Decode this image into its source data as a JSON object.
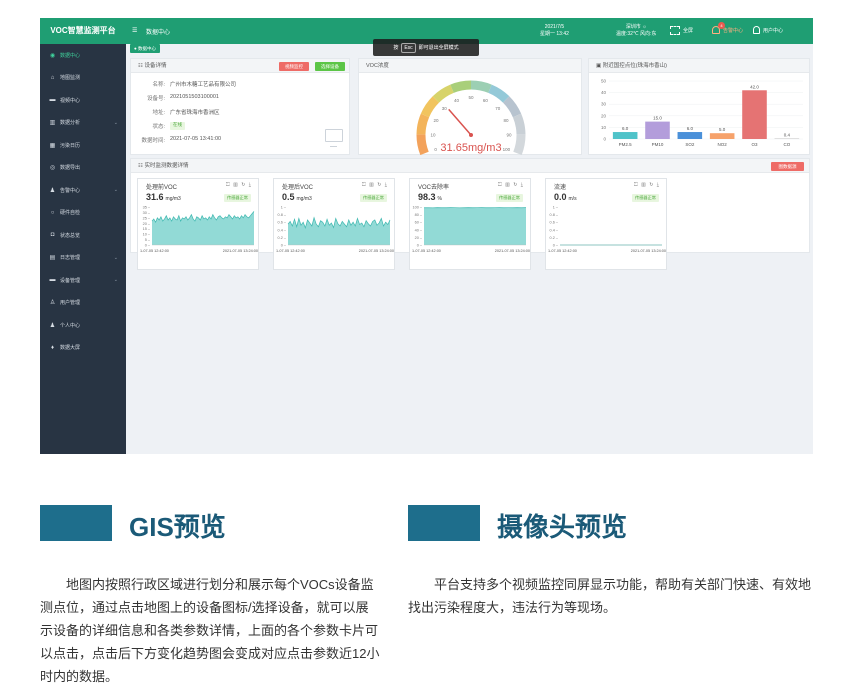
{
  "app": {
    "title": "VOC智慧监测平台",
    "breadcrumb": "数据中心",
    "home_tag": "数据中心"
  },
  "header": {
    "date": "2021/7/5",
    "time": "星期一 13:42",
    "weather_city": "深圳市 ☼",
    "weather_detail": "温度:32℃ 风向:东",
    "fullscreen_label": "全屏",
    "alarm_label": "告警中心",
    "alarm_count": "4",
    "user_label": "用户中心"
  },
  "esc_tip": {
    "prefix": "按",
    "key": "Esc",
    "suffix": "即可退出全屏模式"
  },
  "sidebar": {
    "items": [
      {
        "label": "数据中心",
        "icon": "dashboard-icon",
        "glyph": "◉",
        "active": true,
        "arrow": false
      },
      {
        "label": "地图监测",
        "icon": "map-icon",
        "glyph": "⌂",
        "active": false,
        "arrow": false
      },
      {
        "label": "视频中心",
        "icon": "video-icon",
        "glyph": "▬",
        "active": false,
        "arrow": false
      },
      {
        "label": "数据分析",
        "icon": "analysis-icon",
        "glyph": "▥",
        "active": false,
        "arrow": true
      },
      {
        "label": "污染日历",
        "icon": "calendar-icon",
        "glyph": "▦",
        "active": false,
        "arrow": false
      },
      {
        "label": "数据导出",
        "icon": "export-icon",
        "glyph": "◎",
        "active": false,
        "arrow": false
      },
      {
        "label": "告警中心",
        "icon": "bell-icon",
        "glyph": "♟",
        "active": false,
        "arrow": true
      },
      {
        "label": "硬件自检",
        "icon": "check-icon",
        "glyph": "○",
        "active": false,
        "arrow": false
      },
      {
        "label": "状态总览",
        "icon": "status-icon",
        "glyph": "◘",
        "active": false,
        "arrow": false
      },
      {
        "label": "日志管理",
        "icon": "log-icon",
        "glyph": "▤",
        "active": false,
        "arrow": true
      },
      {
        "label": "设备管理",
        "icon": "device-icon",
        "glyph": "▬",
        "active": false,
        "arrow": true
      },
      {
        "label": "用户管理",
        "icon": "users-icon",
        "glyph": "♙",
        "active": false,
        "arrow": false
      },
      {
        "label": "个人中心",
        "icon": "person-icon",
        "glyph": "♟",
        "active": false,
        "arrow": false
      },
      {
        "label": "数据大屏",
        "icon": "screen-icon",
        "glyph": "♦",
        "active": false,
        "arrow": false
      }
    ]
  },
  "device": {
    "title": "设备详情",
    "btn_monitor": "视频监控",
    "btn_select": "选择设备",
    "rows": [
      {
        "k": "名称:",
        "v": "广州市木糖工艺品有限公司"
      },
      {
        "k": "设备号:",
        "v": "2021051503100001"
      },
      {
        "k": "地址:",
        "v": "广东省珠海市香洲区"
      }
    ],
    "status_key": "状态:",
    "status_val": "在线",
    "time_key": "数据时间:",
    "time_val": "2021-07-05 13:41:00"
  },
  "gauge": {
    "title": "VOC浓度",
    "ticks": [
      "0",
      "10",
      "20",
      "30",
      "40",
      "50",
      "60",
      "70",
      "80",
      "90",
      "100"
    ],
    "max": 100,
    "value": 31.65,
    "value_text": "31.65mg/m3"
  },
  "air": {
    "title": "附近国控点位(珠海市香山)",
    "chart_data": {
      "type": "bar",
      "categories": [
        "PM2.5",
        "PM10",
        "SO2",
        "NO2",
        "O3",
        "CO"
      ],
      "values": [
        6.0,
        15.0,
        6.0,
        5.0,
        42.0,
        0.4
      ],
      "value_labels": [
        "6.0",
        "15.0",
        "6.0",
        "5.0",
        "42.0",
        "0.4"
      ],
      "yticks": [
        "50",
        "40",
        "30",
        "20",
        "10",
        "0"
      ],
      "ylim": [
        0,
        50
      ],
      "colors": [
        "#4fc3c9",
        "#b39ddb",
        "#4a90d9",
        "#f6a26b",
        "#e57373",
        "#bdbdbd"
      ]
    }
  },
  "realtime": {
    "title": "实时监测数据详情",
    "btn_bar": "图数据源",
    "cards": [
      {
        "name": "处理前VOC",
        "value": "31.6",
        "unit": "mg/m3",
        "status": "传感器正常",
        "yticks": [
          "35",
          "30",
          "25",
          "20",
          "15",
          "10",
          "5",
          "0"
        ],
        "ymax": 35,
        "x_start": "1-07-05 12:42:00",
        "x_end": "2021-07-05 13:24:00",
        "chart_data": {
          "type": "area",
          "series": [
            {
              "values": [
                22,
                24,
                21,
                25,
                23,
                26,
                22,
                24,
                27,
                23,
                25,
                22,
                26,
                24,
                23,
                27,
                22,
                25,
                24,
                26,
                23,
                25,
                28,
                24,
                22,
                26,
                25,
                23,
                27,
                24,
                25,
                23,
                26,
                24,
                28,
                25,
                23,
                26,
                27,
                25,
                24,
                26,
                25,
                28,
                26,
                24,
                27,
                25,
                26,
                24,
                27,
                25,
                28,
                26,
                25,
                27,
                29,
                31
              ]
            }
          ]
        }
      },
      {
        "name": "处理后VOC",
        "value": "0.5",
        "unit": "mg/m3",
        "status": "传感器正常",
        "yticks": [
          "1",
          "0.8",
          "0.6",
          "0.4",
          "0.2",
          "0"
        ],
        "ymax": 1,
        "x_start": "1-07-05 12:42:00",
        "x_end": "2021-07-05 13:24:00",
        "chart_data": {
          "type": "area",
          "series": [
            {
              "values": [
                0.55,
                0.62,
                0.5,
                0.68,
                0.48,
                0.7,
                0.52,
                0.6,
                0.45,
                0.66,
                0.58,
                0.5,
                0.72,
                0.55,
                0.48,
                0.64,
                0.6,
                0.5,
                0.68,
                0.52,
                0.58,
                0.46,
                0.7,
                0.56,
                0.5,
                0.62,
                0.55,
                0.48,
                0.66,
                0.52,
                0.6,
                0.5,
                0.7,
                0.54,
                0.58,
                0.48,
                0.64,
                0.56,
                0.5,
                0.62,
                0.66,
                0.52,
                0.58,
                0.7,
                0.5,
                0.6,
                0.54,
                0.66
              ]
            }
          ]
        }
      },
      {
        "name": "VOC去除率",
        "value": "98.3",
        "unit": "%",
        "status": "传感器正常",
        "yticks": [
          "100",
          "80",
          "60",
          "40",
          "20",
          "0"
        ],
        "ymax": 100,
        "x_start": "1-07-05 12:42:00",
        "x_end": "2021-07-05 13:24:00",
        "chart_data": {
          "type": "area",
          "series": [
            {
              "values": [
                98,
                98.2,
                97.9,
                98.4,
                98.1,
                98,
                98.3,
                98.2,
                97.8,
                98.1,
                98.4,
                98,
                98.2,
                98.3,
                98,
                98.1,
                98.2,
                98.3,
                98,
                98.2,
                98.1,
                98.4,
                98,
                98.3
              ]
            }
          ]
        }
      },
      {
        "name": "流速",
        "value": "0.0",
        "unit": "m/s",
        "status": "传感器正常",
        "yticks": [
          "1",
          "0.8",
          "0.6",
          "0.4",
          "0.2",
          "0"
        ],
        "ymax": 1,
        "x_start": "1-07-05 12:42:00",
        "x_end": "2021-07-05 13:24:00",
        "chart_data": {
          "type": "line",
          "series": [
            {
              "values": [
                0,
                0,
                0,
                0,
                0,
                0,
                0,
                0,
                0,
                0,
                0,
                0
              ]
            }
          ]
        }
      }
    ]
  },
  "sections": {
    "gis_title": "GIS预览",
    "gis_desc": "地图内按照行政区域进行划分和展示每个VOCs设备监测点位，通过点击地图上的设备图标/选择设备，就可以展示设备的详细信息和各类参数详情，上面的各个参数卡片可以点击，点击后下方变化趋势图会变成对应点击参数近12小时内的数据。",
    "cam_title": "摄像头预览",
    "cam_desc": "平台支持多个视频监控同屏显示功能，帮助有关部门快速、有效地找出污染程度大，违法行为等现场。"
  },
  "colors": {
    "brand": "#1f9e73",
    "sidebar": "#283443",
    "area": "#7fd3cf",
    "section": "#1e6e8c"
  }
}
